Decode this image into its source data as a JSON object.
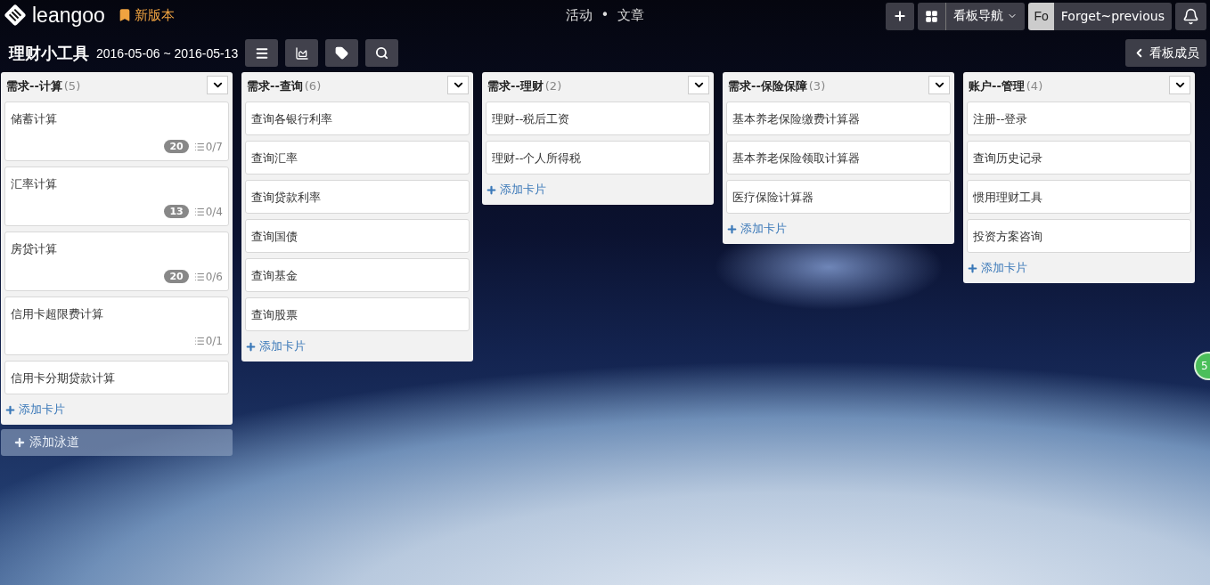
{
  "header": {
    "logo": "leangoo",
    "new_version": "新版本",
    "nav": [
      "活动",
      "文章"
    ],
    "nav_separator": "•",
    "board_nav": "看板导航",
    "user_initials": "Fo",
    "user_name": "Forget~previous"
  },
  "board": {
    "title": "理财小工具",
    "dates": "2016-05-06 ~ 2016-05-13",
    "members_button": "看板成员"
  },
  "lanes": [
    {
      "title": "需求--计算",
      "count": "(5)",
      "cards": [
        {
          "title": "储蓄计算",
          "points": "20",
          "checklist": "0/7"
        },
        {
          "title": "汇率计算",
          "points": "13",
          "checklist": "0/4"
        },
        {
          "title": "房贷计算",
          "points": "20",
          "checklist": "0/6"
        },
        {
          "title": "信用卡超限费计算",
          "checklist": "0/1"
        },
        {
          "title": "信用卡分期贷款计算"
        }
      ],
      "add_card": "添加卡片"
    },
    {
      "title": "需求--查询",
      "count": "(6)",
      "cards": [
        {
          "title": "查询各银行利率"
        },
        {
          "title": "查询汇率"
        },
        {
          "title": "查询贷款利率"
        },
        {
          "title": "查询国债"
        },
        {
          "title": "查询基金"
        },
        {
          "title": "查询股票"
        }
      ],
      "add_card": "添加卡片"
    },
    {
      "title": "需求--理财",
      "count": "(2)",
      "cards": [
        {
          "title": "理财--税后工资"
        },
        {
          "title": "理财--个人所得税"
        }
      ],
      "add_card": "添加卡片"
    },
    {
      "title": "需求--保险保障",
      "count": "(3)",
      "cards": [
        {
          "title": "基本养老保险缴费计算器"
        },
        {
          "title": "基本养老保险领取计算器"
        },
        {
          "title": "医疗保险计算器"
        }
      ],
      "add_card": "添加卡片"
    },
    {
      "title": "账户--管理",
      "count": "(4)",
      "cards": [
        {
          "title": "注册--登录"
        },
        {
          "title": "查询历史记录"
        },
        {
          "title": "惯用理财工具"
        },
        {
          "title": "投资方案咨询"
        }
      ],
      "add_card": "添加卡片"
    }
  ],
  "add_lane": "添加泳道",
  "side_badge": "5"
}
